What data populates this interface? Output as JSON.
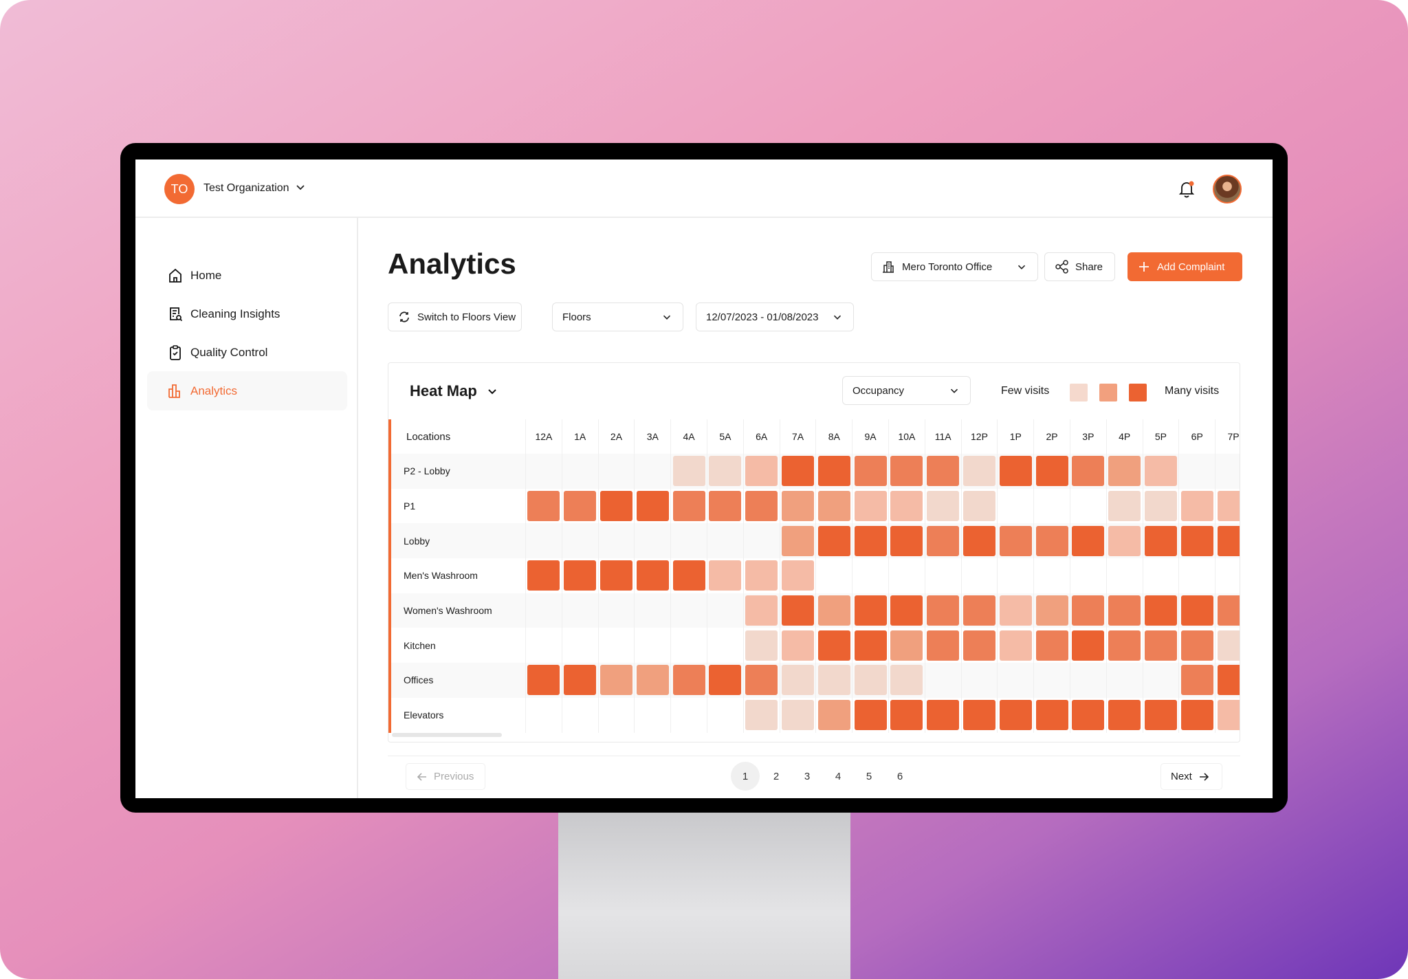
{
  "org": {
    "initials": "TO",
    "name": "Test Organization"
  },
  "sidebar": {
    "items": [
      {
        "label": "Home",
        "icon": "home-icon"
      },
      {
        "label": "Cleaning Insights",
        "icon": "document-search-icon"
      },
      {
        "label": "Quality Control",
        "icon": "clipboard-check-icon"
      },
      {
        "label": "Analytics",
        "icon": "bar-chart-icon",
        "active": true
      }
    ]
  },
  "page": {
    "title": "Analytics"
  },
  "toolbar": {
    "location": "Mero Toronto Office",
    "share": "Share",
    "add_complaint": "Add Complaint",
    "switch_view": "Switch to Floors View",
    "floors": "Floors",
    "date_range": "12/07/2023 - 01/08/2023"
  },
  "heatmap": {
    "title": "Heat Map",
    "metric": "Occupancy",
    "legend_few": "Few visits",
    "legend_many": "Many visits"
  },
  "colors": {
    "accent": "#f26a33",
    "levels": [
      "transparent",
      "#f2d8cc",
      "#f5bba6",
      "#f0a07e",
      "#ed7f57",
      "#eb6231"
    ]
  },
  "chart_data": {
    "type": "heatmap",
    "row_header": "Locations",
    "columns": [
      "12A",
      "1A",
      "2A",
      "3A",
      "4A",
      "5A",
      "6A",
      "7A",
      "8A",
      "9A",
      "10A",
      "11A",
      "12P",
      "1P",
      "2P",
      "3P",
      "4P",
      "5P",
      "6P",
      "7P"
    ],
    "scale": "0 = no visits, 5 = many visits",
    "rows": [
      {
        "name": "P2 - Lobby",
        "values": [
          0,
          0,
          0,
          0,
          1,
          1,
          2,
          5,
          5,
          4,
          4,
          4,
          1,
          5,
          5,
          4,
          3,
          2,
          0,
          0
        ]
      },
      {
        "name": "P1",
        "values": [
          4,
          4,
          5,
          5,
          4,
          4,
          4,
          3,
          3,
          2,
          2,
          1,
          1,
          0,
          0,
          0,
          1,
          1,
          2,
          2
        ]
      },
      {
        "name": "Lobby",
        "values": [
          0,
          0,
          0,
          0,
          0,
          0,
          0,
          3,
          5,
          5,
          5,
          4,
          5,
          4,
          4,
          5,
          2,
          5,
          5,
          5
        ]
      },
      {
        "name": "Men's Washroom",
        "values": [
          5,
          5,
          5,
          5,
          5,
          2,
          2,
          2,
          0,
          0,
          0,
          0,
          0,
          0,
          0,
          0,
          0,
          0,
          0,
          0
        ]
      },
      {
        "name": "Women's Washroom",
        "values": [
          0,
          0,
          0,
          0,
          0,
          0,
          2,
          5,
          3,
          5,
          5,
          4,
          4,
          2,
          3,
          4,
          4,
          5,
          5,
          4
        ]
      },
      {
        "name": "Kitchen",
        "values": [
          0,
          0,
          0,
          0,
          0,
          0,
          1,
          2,
          5,
          5,
          3,
          4,
          4,
          2,
          4,
          5,
          4,
          4,
          4,
          1
        ]
      },
      {
        "name": "Offices",
        "values": [
          5,
          5,
          3,
          3,
          4,
          5,
          4,
          1,
          1,
          1,
          1,
          0,
          0,
          0,
          0,
          0,
          0,
          0,
          4,
          5
        ]
      },
      {
        "name": "Elevators",
        "values": [
          0,
          0,
          0,
          0,
          0,
          0,
          1,
          1,
          3,
          5,
          5,
          5,
          5,
          5,
          5,
          5,
          5,
          5,
          5,
          2
        ]
      }
    ]
  },
  "pagination": {
    "previous": "Previous",
    "next": "Next",
    "pages": [
      "1",
      "2",
      "3",
      "4",
      "5",
      "6"
    ],
    "current": "1"
  }
}
